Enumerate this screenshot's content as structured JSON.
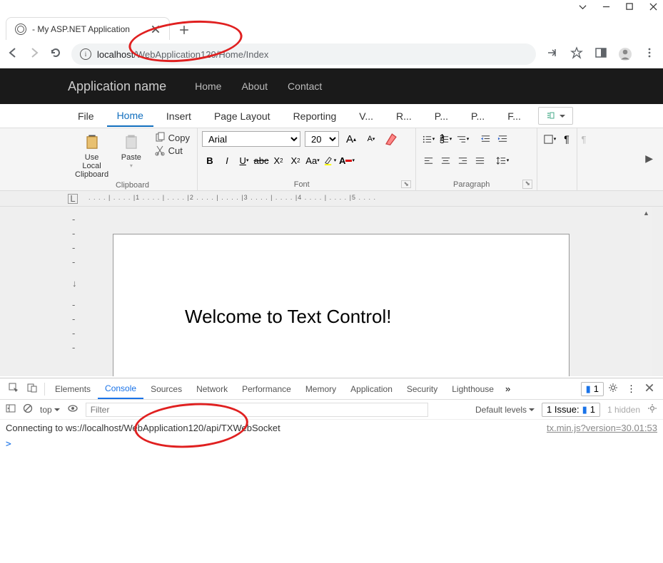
{
  "browser": {
    "tab_title": "- My ASP.NET Application",
    "url_dark": "localhost",
    "url_rest": "/WebApplication120/Home/Index"
  },
  "appnav": {
    "brand": "Application name",
    "links": [
      "Home",
      "About",
      "Contact"
    ]
  },
  "ribbon_tabs": [
    "File",
    "Home",
    "Insert",
    "Page Layout",
    "Reporting",
    "V...",
    "R...",
    "P...",
    "P...",
    "F..."
  ],
  "ribbon_active_index": 1,
  "clipboard": {
    "use_local": "Use Local\nClipboard",
    "paste": "Paste",
    "copy": "Copy",
    "cut": "Cut",
    "group_label": "Clipboard"
  },
  "font": {
    "name": "Arial",
    "size": "20",
    "group_label": "Font"
  },
  "paragraph": {
    "group_label": "Paragraph"
  },
  "document_text": "Welcome to Text Control!",
  "ruler_marks": ". . . . | . . . . |1 . . . . | . . . . |2 . . . . | . . . . |3 . . . . | . . . . |4 . . . . | . . . . |5 . . . .",
  "devtools": {
    "tabs": [
      "Elements",
      "Console",
      "Sources",
      "Network",
      "Performance",
      "Memory",
      "Application",
      "Security",
      "Lighthouse"
    ],
    "active_index": 1,
    "messages_badge": "1",
    "toolbar": {
      "top": "top",
      "filter_placeholder": "Filter",
      "levels": "Default levels",
      "issue_label": "1 Issue:",
      "issue_count": "1",
      "hidden": "1 hidden"
    },
    "console_message": "Connecting to ws://localhost/WebApplication120/api/TXWebSocket",
    "console_source": "tx.min.js?version=30.01:53",
    "prompt": ">"
  }
}
